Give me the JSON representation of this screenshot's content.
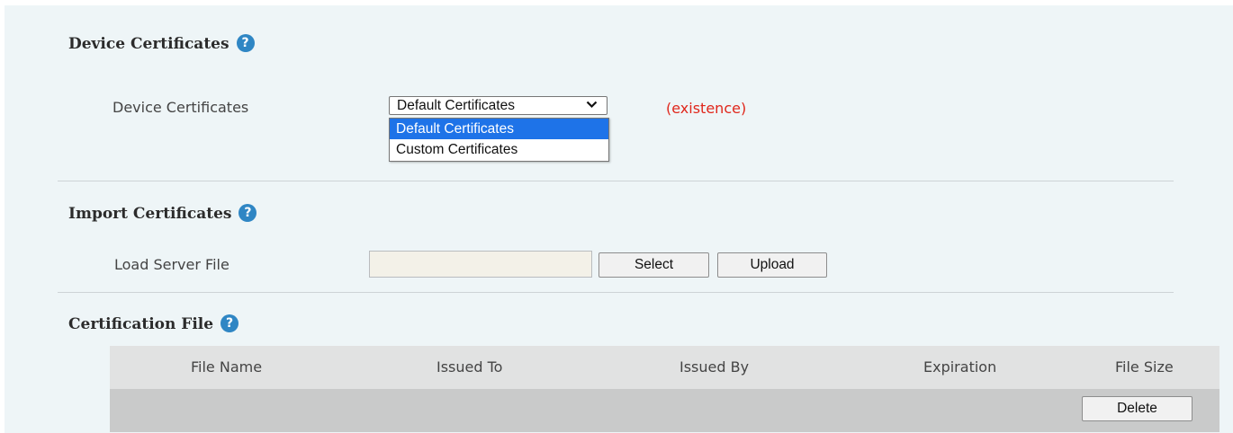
{
  "device_certificates": {
    "title": "Device Certificates",
    "help_glyph": "?",
    "field_label": "Device Certificates",
    "select_value": "Default Certificates",
    "options": [
      "Default Certificates",
      "Custom Certificates"
    ],
    "status": "(existence)"
  },
  "import_certificates": {
    "title": "Import Certificates",
    "help_glyph": "?",
    "field_label": "Load Server File",
    "file_value": "",
    "select_button": "Select",
    "upload_button": "Upload"
  },
  "certification_file": {
    "title": "Certification File",
    "help_glyph": "?",
    "columns": [
      "File Name",
      "Issued To",
      "Issued By",
      "Expiration",
      "File Size"
    ],
    "delete_button": "Delete"
  },
  "colors": {
    "panel_bg": "#eef5f7",
    "help_icon": "#2f86c4",
    "status_text": "#e0261b",
    "option_highlight": "#1e73e8"
  },
  "icons": {
    "help": "question-circle-icon",
    "dropdown": "chevron-down-icon"
  }
}
